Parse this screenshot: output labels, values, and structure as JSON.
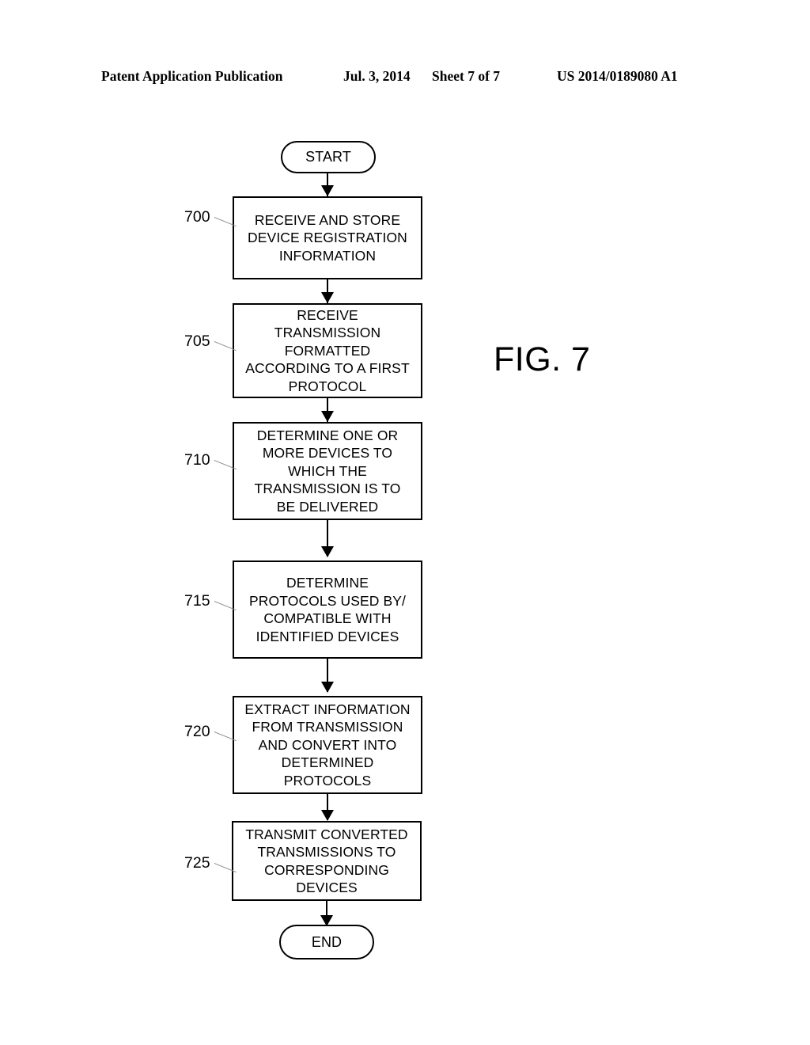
{
  "header": {
    "publication": "Patent Application Publication",
    "date": "Jul. 3, 2014",
    "sheet": "Sheet 7 of 7",
    "patent_number": "US 2014/0189080 A1"
  },
  "figure": {
    "label": "FIG. 7"
  },
  "flowchart": {
    "start": {
      "label": "START"
    },
    "end": {
      "label": "END"
    },
    "steps": [
      {
        "ref": "700",
        "lines": [
          "RECEIVE AND STORE",
          "DEVICE REGISTRATION",
          "INFORMATION"
        ]
      },
      {
        "ref": "705",
        "lines": [
          "RECEIVE",
          "TRANSMISSION",
          "FORMATTED",
          "ACCORDING TO A FIRST",
          "PROTOCOL"
        ]
      },
      {
        "ref": "710",
        "lines": [
          "DETERMINE ONE OR",
          "MORE DEVICES TO",
          "WHICH THE",
          "TRANSMISSION IS TO",
          "BE DELIVERED"
        ]
      },
      {
        "ref": "715",
        "lines": [
          "DETERMINE",
          "PROTOCOLS USED BY/",
          "COMPATIBLE WITH",
          "IDENTIFIED DEVICES"
        ]
      },
      {
        "ref": "720",
        "lines": [
          "EXTRACT INFORMATION",
          "FROM TRANSMISSION",
          "AND CONVERT INTO",
          "DETERMINED",
          "PROTOCOLS"
        ]
      },
      {
        "ref": "725",
        "lines": [
          "TRANSMIT CONVERTED",
          "TRANSMISSIONS TO",
          "CORRESPONDING",
          "DEVICES"
        ]
      }
    ]
  },
  "colors": {
    "ink": "#000000",
    "paper": "#ffffff",
    "leader": "#8c8c8c"
  }
}
